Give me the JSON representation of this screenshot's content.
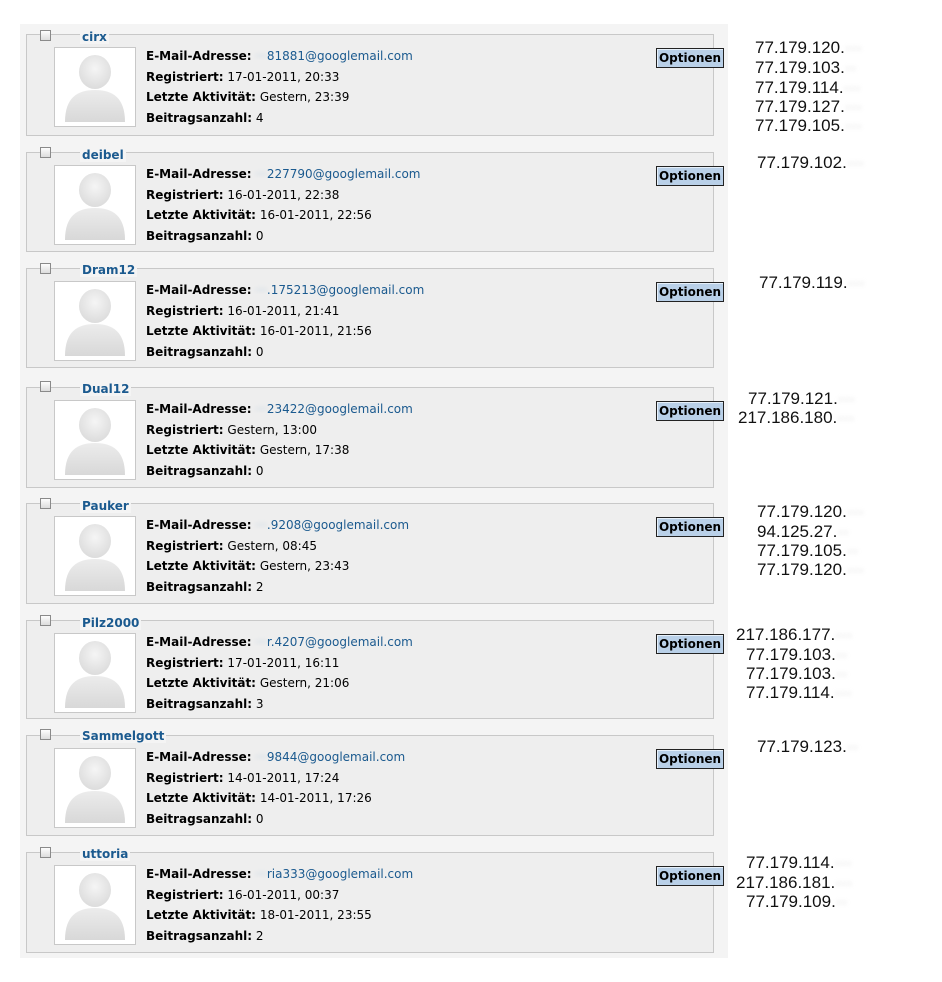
{
  "labels": {
    "email": "E-Mail-Adresse:",
    "registered": "Registriert:",
    "last_activity": "Letzte Aktivität:",
    "posts": "Beitragsanzahl:",
    "options": "Optionen"
  },
  "users": [
    {
      "name": "cirx",
      "email_hidden": "···",
      "email_visible": "81881@googlemail.com",
      "registered": "17-01-2011, 20:33",
      "last_activity": "Gestern, 23:39",
      "posts": "4",
      "ips": [
        {
          "prefix": "77.179.120.",
          "hidden": "···"
        },
        {
          "prefix": "77.179.103.",
          "hidden": "··"
        },
        {
          "prefix": "77.179.114.",
          "hidden": "···"
        },
        {
          "prefix": "77.179.127.",
          "hidden": "···"
        },
        {
          "prefix": "77.179.105.",
          "hidden": "···"
        }
      ]
    },
    {
      "name": "deibel",
      "email_hidden": "···",
      "email_visible": "227790@googlemail.com",
      "registered": "16-01-2011, 22:38",
      "last_activity": "16-01-2011, 22:56",
      "posts": "0",
      "ips": [
        {
          "prefix": "77.179.102.",
          "hidden": "···"
        }
      ]
    },
    {
      "name": "Dram12",
      "email_hidden": "···",
      "email_visible": ".175213@googlemail.com",
      "registered": "16-01-2011, 21:41",
      "last_activity": "16-01-2011, 21:56",
      "posts": "0",
      "ips": [
        {
          "prefix": "77.179.119.",
          "hidden": "···"
        }
      ]
    },
    {
      "name": "Dual12",
      "email_hidden": "···",
      "email_visible": "23422@googlemail.com",
      "registered": "Gestern, 13:00",
      "last_activity": "Gestern, 17:38",
      "posts": "0",
      "ips": [
        {
          "prefix": "77.179.121.",
          "hidden": "···"
        },
        {
          "prefix": "217.186.180.",
          "hidden": "···"
        }
      ]
    },
    {
      "name": "Pauker",
      "email_hidden": "···",
      "email_visible": ".9208@googlemail.com",
      "registered": "Gestern, 08:45",
      "last_activity": "Gestern, 23:43",
      "posts": "2",
      "ips": [
        {
          "prefix": "77.179.120.",
          "hidden": "···"
        },
        {
          "prefix": "94.125.27.",
          "hidden": "··"
        },
        {
          "prefix": "77.179.105.",
          "hidden": "··"
        },
        {
          "prefix": "77.179.120.",
          "hidden": "···"
        }
      ]
    },
    {
      "name": "Pilz2000",
      "email_hidden": "···",
      "email_visible": "r.4207@googlemail.com",
      "registered": "17-01-2011, 16:11",
      "last_activity": "Gestern, 21:06",
      "posts": "3",
      "ips": [
        {
          "prefix": "217.186.177.",
          "hidden": "···"
        },
        {
          "prefix": "77.179.103.",
          "hidden": "··"
        },
        {
          "prefix": "77.179.103.",
          "hidden": "··"
        },
        {
          "prefix": "77.179.114.",
          "hidden": "···"
        }
      ]
    },
    {
      "name": "Sammelgott",
      "email_hidden": "···",
      "email_visible": "9844@googlemail.com",
      "registered": "14-01-2011, 17:24",
      "last_activity": "14-01-2011, 17:26",
      "posts": "0",
      "ips": [
        {
          "prefix": "77.179.123.",
          "hidden": "··"
        }
      ]
    },
    {
      "name": "uttoria",
      "email_hidden": "···",
      "email_visible": "ria333@googlemail.com",
      "registered": "16-01-2011, 00:37",
      "last_activity": "18-01-2011, 23:55",
      "posts": "2",
      "ips": [
        {
          "prefix": "77.179.114.",
          "hidden": "···"
        },
        {
          "prefix": "217.186.181.",
          "hidden": "···"
        },
        {
          "prefix": "77.179.109.",
          "hidden": "··"
        }
      ]
    }
  ]
}
